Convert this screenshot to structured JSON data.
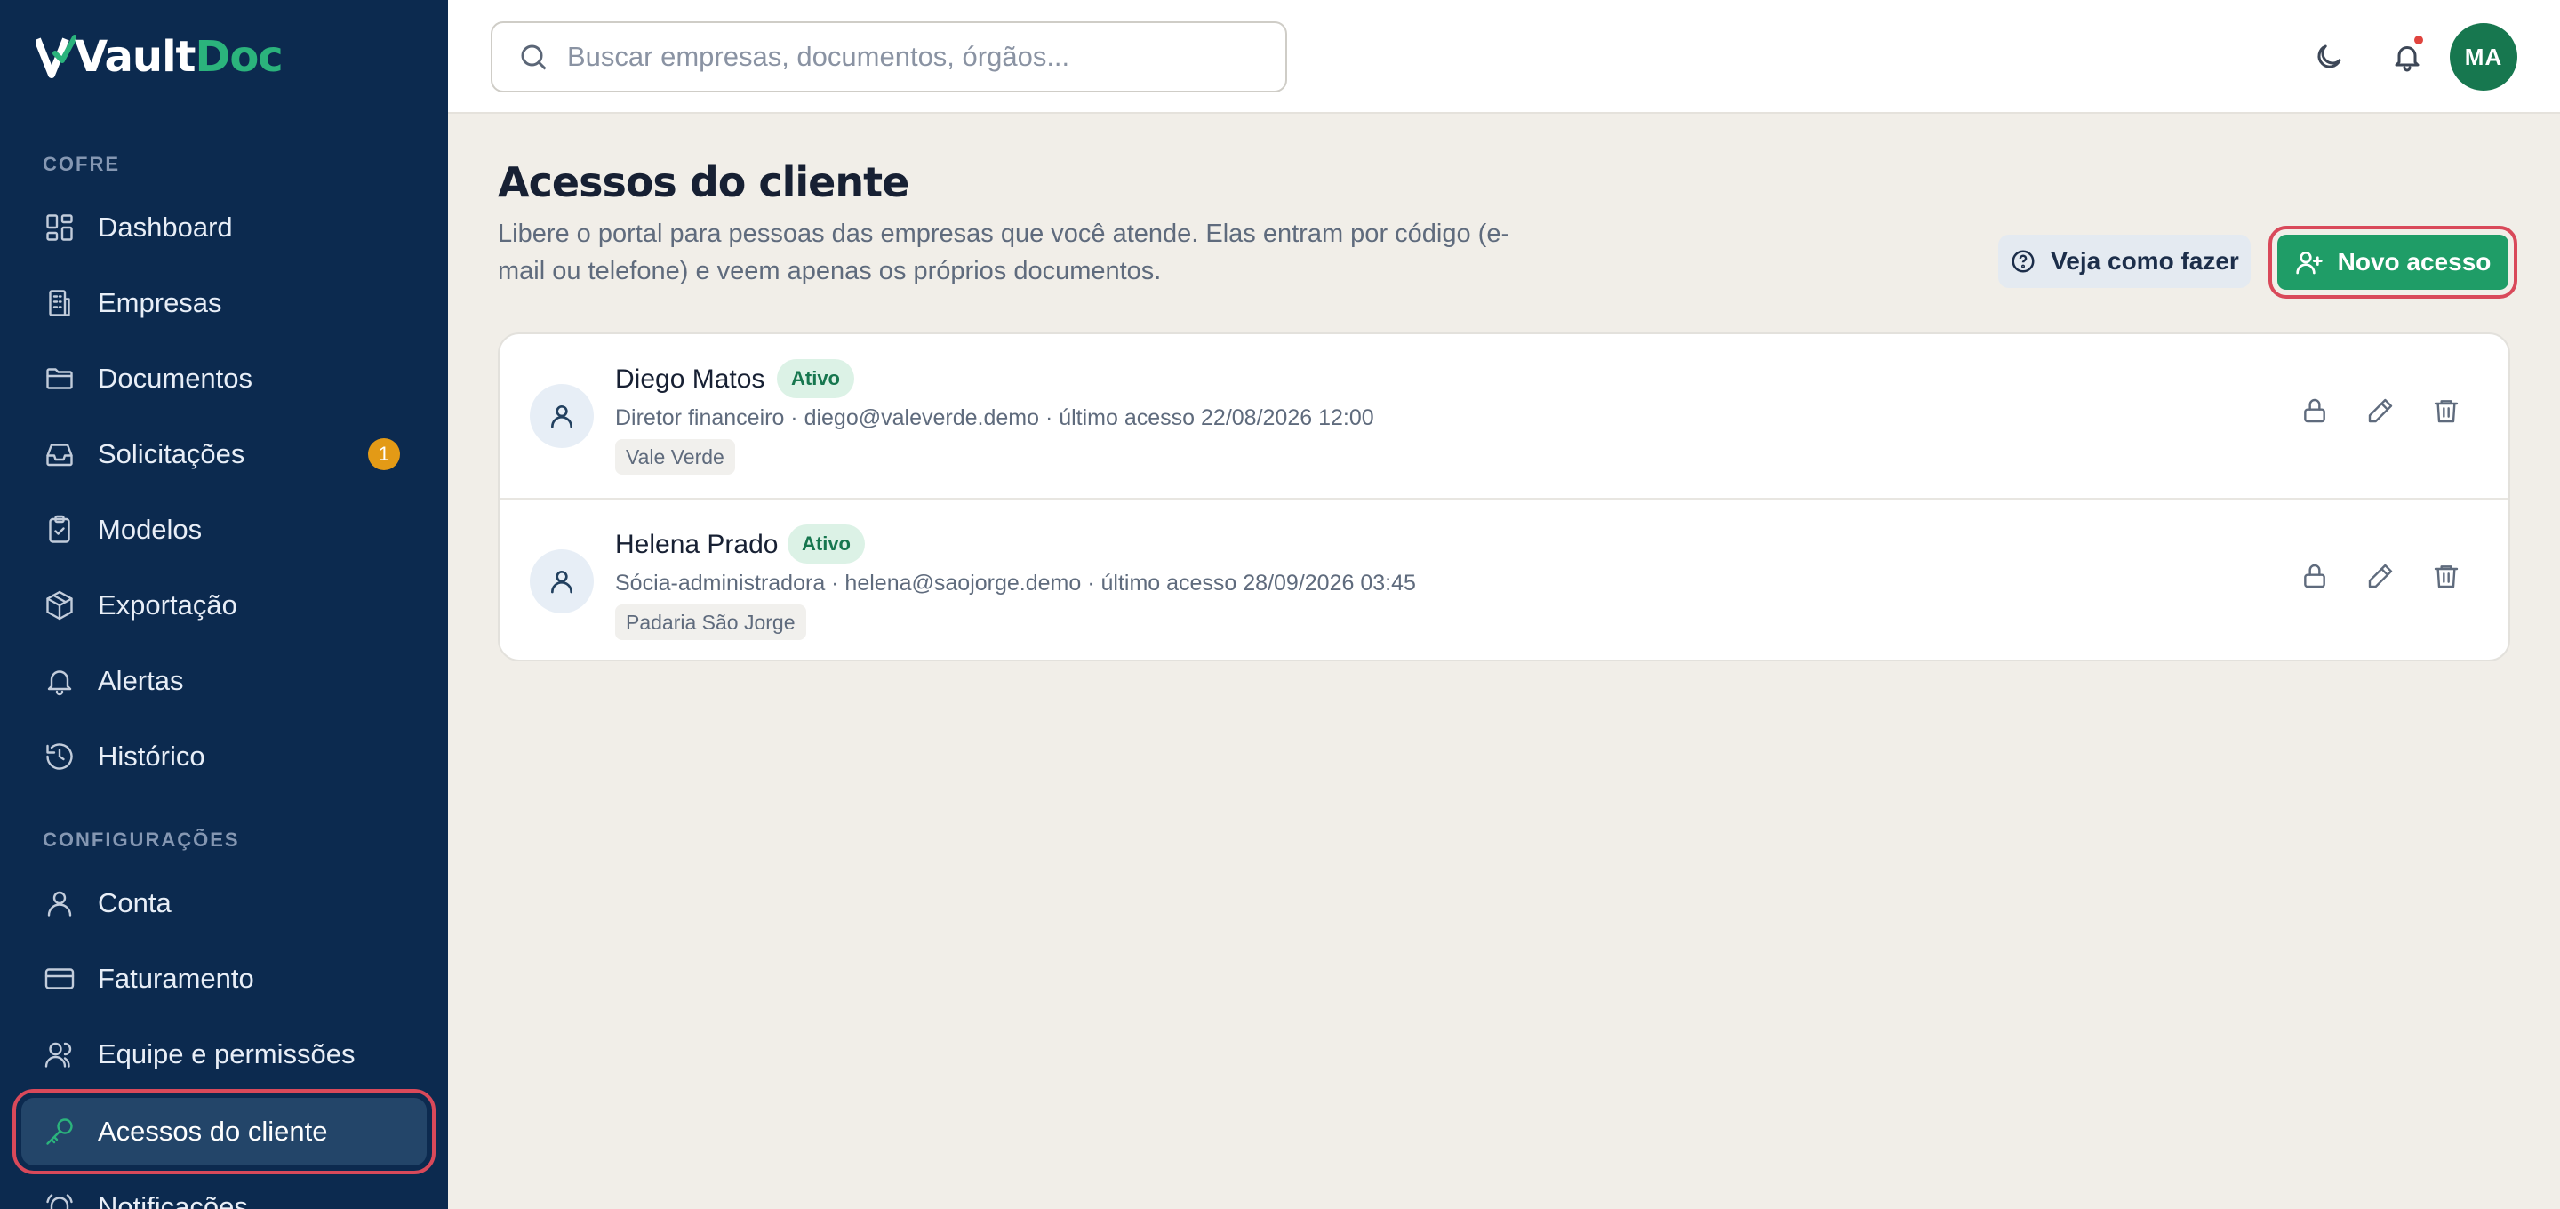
{
  "app": {
    "logo_part1": "Vault",
    "logo_part2": "Doc"
  },
  "sidebar": {
    "section_vault": "COFRE",
    "section_settings": "CONFIGURAÇÕES",
    "items": [
      {
        "label": "Dashboard",
        "icon": "dashboard-icon"
      },
      {
        "label": "Empresas",
        "icon": "building-icon"
      },
      {
        "label": "Documentos",
        "icon": "folder-icon"
      },
      {
        "label": "Solicitações",
        "icon": "inbox-icon",
        "badge": "1"
      },
      {
        "label": "Modelos",
        "icon": "clipboard-check-icon"
      },
      {
        "label": "Exportação",
        "icon": "package-icon"
      },
      {
        "label": "Alertas",
        "icon": "bell-icon"
      },
      {
        "label": "Histórico",
        "icon": "history-icon"
      },
      {
        "label": "Conta",
        "icon": "user-icon"
      },
      {
        "label": "Faturamento",
        "icon": "credit-card-icon"
      },
      {
        "label": "Equipe e permissões",
        "icon": "users-icon"
      },
      {
        "label": "Acessos do cliente",
        "icon": "key-icon",
        "active": true
      },
      {
        "label": "Notificações",
        "icon": "bell-ring-icon"
      }
    ]
  },
  "topbar": {
    "search_placeholder": "Buscar empresas, documentos, órgãos...",
    "avatar_initials": "MA"
  },
  "page": {
    "title": "Acessos do cliente",
    "description": "Libere o portal para pessoas das empresas que você atende. Elas entram por código (e-mail ou telefone) e veem apenas os próprios documentos.",
    "help_button": "Veja como fazer",
    "new_button": "Novo acesso"
  },
  "accesses": [
    {
      "name": "Diego Matos",
      "status": "Ativo",
      "meta": "Diretor financeiro · diego@valeverde.demo · último acesso 22/08/2026 12:00",
      "company": "Vale Verde"
    },
    {
      "name": "Helena Prado",
      "status": "Ativo",
      "meta": "Sócia-administradora · helena@saojorge.demo · último acesso 28/09/2026 03:45",
      "company": "Padaria São Jorge"
    }
  ],
  "colors": {
    "sidebar_bg": "#0c2a4f",
    "accent_green": "#1f9d67",
    "highlight_red": "#d9495a",
    "badge_orange": "#e39a16"
  }
}
